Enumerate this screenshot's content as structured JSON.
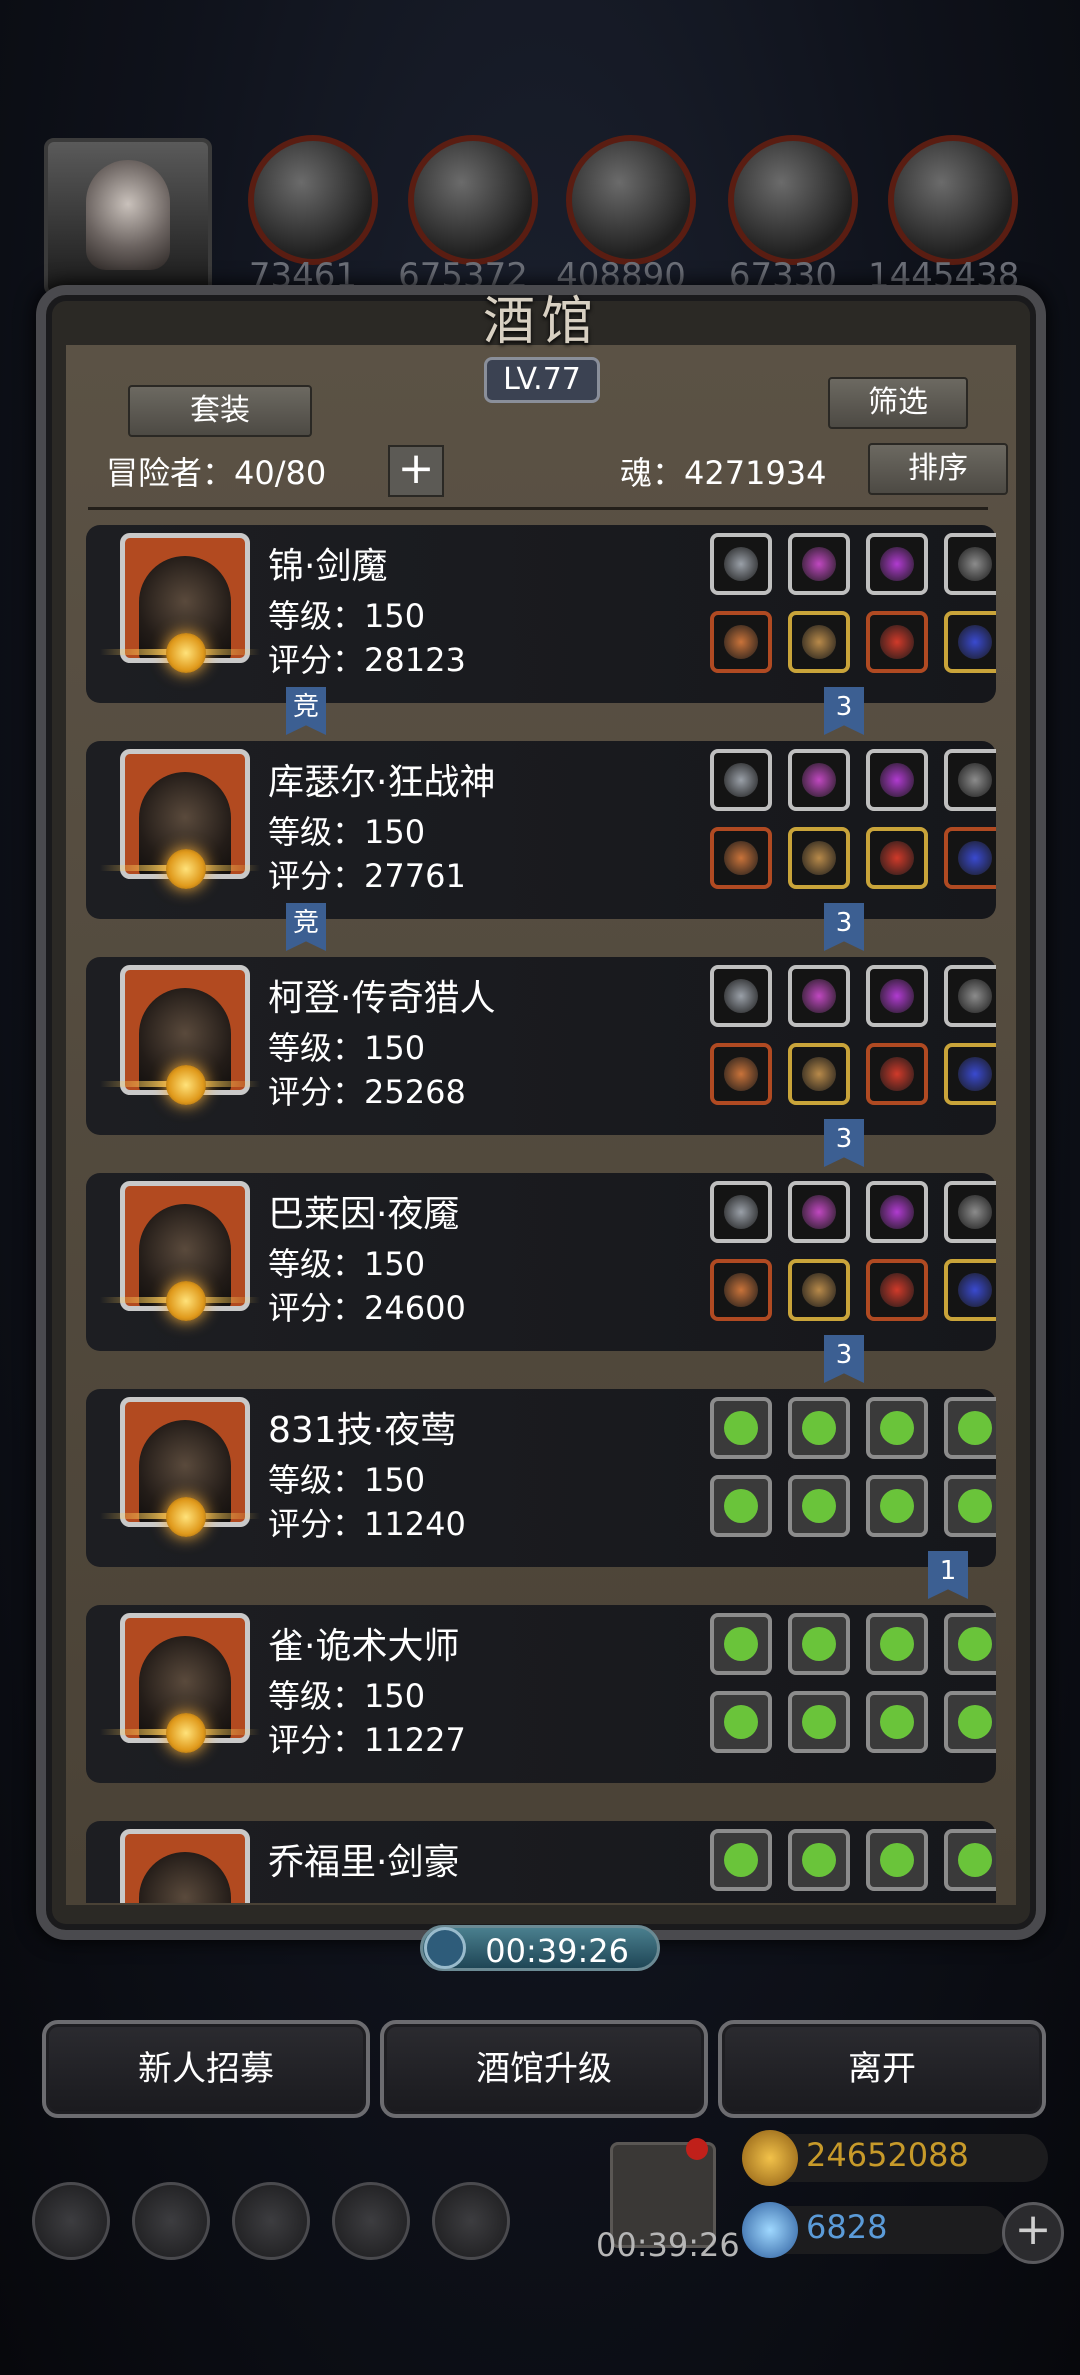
{
  "top_resources": [
    "73461",
    "675372",
    "408890",
    "67330",
    "1445438"
  ],
  "panel": {
    "title": "酒馆",
    "level": "LV.77"
  },
  "controls": {
    "set_button": "套装",
    "filter_button": "筛选",
    "sort_button": "排序",
    "adventurers": "冒险者：40/80",
    "soul": "魂：4271934",
    "add": "+"
  },
  "heroes": [
    {
      "name": "锦·剑魔",
      "level": "等级：150",
      "score": "评分：28123",
      "tag_left": "竞",
      "tag_right": "3"
    },
    {
      "name": "库瑟尔·狂战神",
      "level": "等级：150",
      "score": "评分：27761",
      "tag_left": "竞",
      "tag_right": "3"
    },
    {
      "name": "柯登·传奇猎人",
      "level": "等级：150",
      "score": "评分：25268",
      "tag_left": "",
      "tag_right": "3"
    },
    {
      "name": "巴莱因·夜魇",
      "level": "等级：150",
      "score": "评分：24600",
      "tag_left": "",
      "tag_right": "3"
    },
    {
      "name": "831技·夜莺",
      "level": "等级：150",
      "score": "评分：11240",
      "tag_left": "",
      "tag_right": "1"
    },
    {
      "name": "雀·诡术大师",
      "level": "等级：150",
      "score": "评分：11227",
      "tag_left": "",
      "tag_right": ""
    },
    {
      "name": "乔福里·剑豪",
      "level": "",
      "score": "",
      "tag_left": "",
      "tag_right": ""
    }
  ],
  "timer": "00:39:26",
  "buttons": {
    "recruit": "新人招募",
    "upgrade": "酒馆升级",
    "leave": "离开"
  },
  "bottom": {
    "gift_timer": "00:39:26",
    "gold": "24652088",
    "gems": "6828"
  },
  "colors": {
    "gold": "#c9a43a",
    "green": "#6ac43a",
    "tag_blue": "#3c5f92"
  }
}
